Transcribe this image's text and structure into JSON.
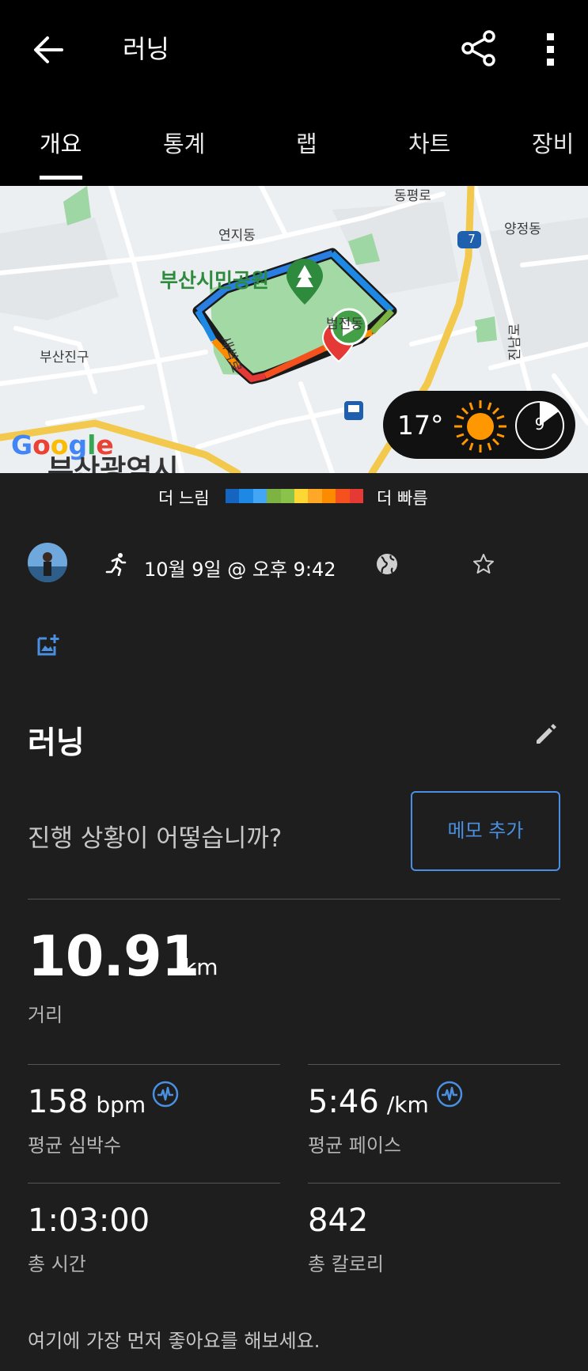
{
  "app_bar": {
    "title": "러닝",
    "back_icon": "arrow-left-icon",
    "share_icon": "share-icon",
    "more_icon": "more-vert-icon"
  },
  "tabs": [
    {
      "label": "개요",
      "active": true
    },
    {
      "label": "통계",
      "active": false
    },
    {
      "label": "랩",
      "active": false
    },
    {
      "label": "차트",
      "active": false
    },
    {
      "label": "장비",
      "active": false
    }
  ],
  "map": {
    "labels": {
      "dongpyeongro": "동평로",
      "yeonjidong": "연지동",
      "yangjeongdong": "양정동",
      "park": "부산시민공원",
      "jinnamro": "진남로",
      "busanjingu": "부산진구",
      "saebatro": "새싹로",
      "route_number": "7",
      "dong_label": "범전동",
      "google": "Google",
      "city": "부산광역시"
    },
    "weather": {
      "temperature": "17°",
      "moon_phase": "9"
    }
  },
  "pace_legend": {
    "slow_label": "더 느림",
    "fast_label": "더 빠름",
    "colors": [
      "#1565c0",
      "#1e88e5",
      "#42a5f5",
      "#7cb342",
      "#8bc34a",
      "#fdd835",
      "#ffa726",
      "#fb8c00",
      "#f4511e",
      "#e53935"
    ]
  },
  "activity": {
    "datetime": "10월 9일 @ 오후 9:42",
    "title": "러닝",
    "question": "진행 상황이 어떻습니까?",
    "memo_button": "메모 추가",
    "distance": {
      "value": "10.91",
      "unit": "km",
      "label": "거리"
    },
    "stats": {
      "avg_hr": {
        "value": "158",
        "unit": "bpm",
        "label": "평균 심박수"
      },
      "avg_pace": {
        "value": "5:46",
        "unit": "/km",
        "label": "평균 페이스"
      },
      "total_time": {
        "value": "1:03:00",
        "label": "총 시간"
      },
      "calories": {
        "value": "842",
        "label": "총 칼로리"
      }
    },
    "like_prompt": "여기에 가장 먼저 좋아요를 해보세요."
  }
}
